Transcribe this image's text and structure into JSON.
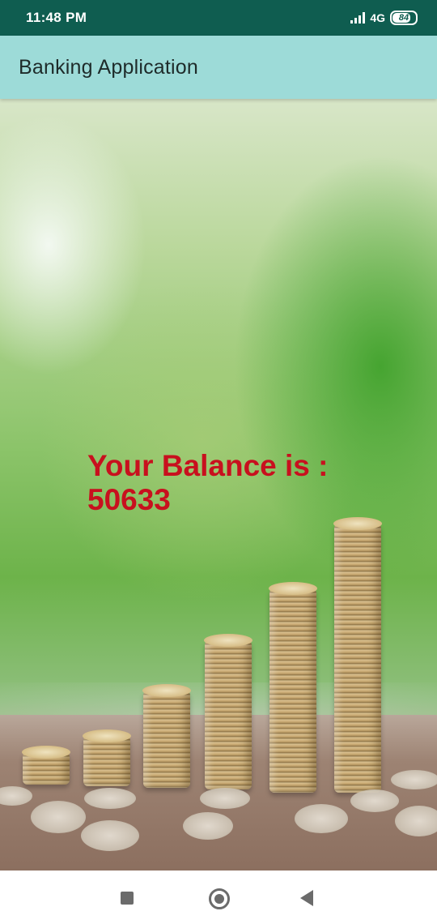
{
  "status_bar": {
    "time": "11:48 PM",
    "network": "4G",
    "battery_level": "84",
    "icons": [
      "signal-icon",
      "battery-icon"
    ]
  },
  "app_bar": {
    "title": "Banking Application"
  },
  "content": {
    "background_image": "coin-stacks-photo",
    "balance_label": "Your Balance is :",
    "balance_value": "50633"
  },
  "nav_bar": {
    "icons": [
      "recents-icon",
      "home-icon",
      "back-icon"
    ]
  },
  "colors": {
    "status_bar": "#0f5d50",
    "app_bar": "#9ddbd8",
    "balance_text": "#c8101e"
  }
}
